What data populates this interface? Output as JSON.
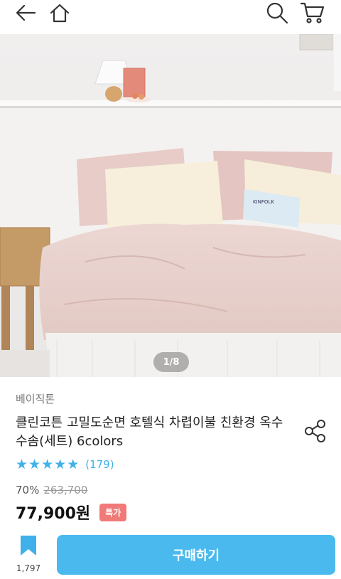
{
  "nav": {
    "back_icon": "arrow-left-icon",
    "home_icon": "home-icon",
    "search_icon": "search-icon",
    "cart_icon": "cart-icon"
  },
  "hero": {
    "pager_text": "1/8",
    "book_text": "KINFOLK"
  },
  "product": {
    "brand": "베이직톤",
    "title": "클린코튼 고밀도순면 호텔식 차렵이불 친환경 옥수수솜(세트) 6colors",
    "rating": 5,
    "review_count": "(179)",
    "discount": "70%",
    "original_price": "263,700",
    "price": "77,900원",
    "badge": "특가"
  },
  "bottom": {
    "bookmark_count": "1,797",
    "buy_label": "구매하기"
  },
  "colors": {
    "accent": "#49b9ee",
    "star": "#3fb0ea",
    "badge": "#f07a78"
  }
}
